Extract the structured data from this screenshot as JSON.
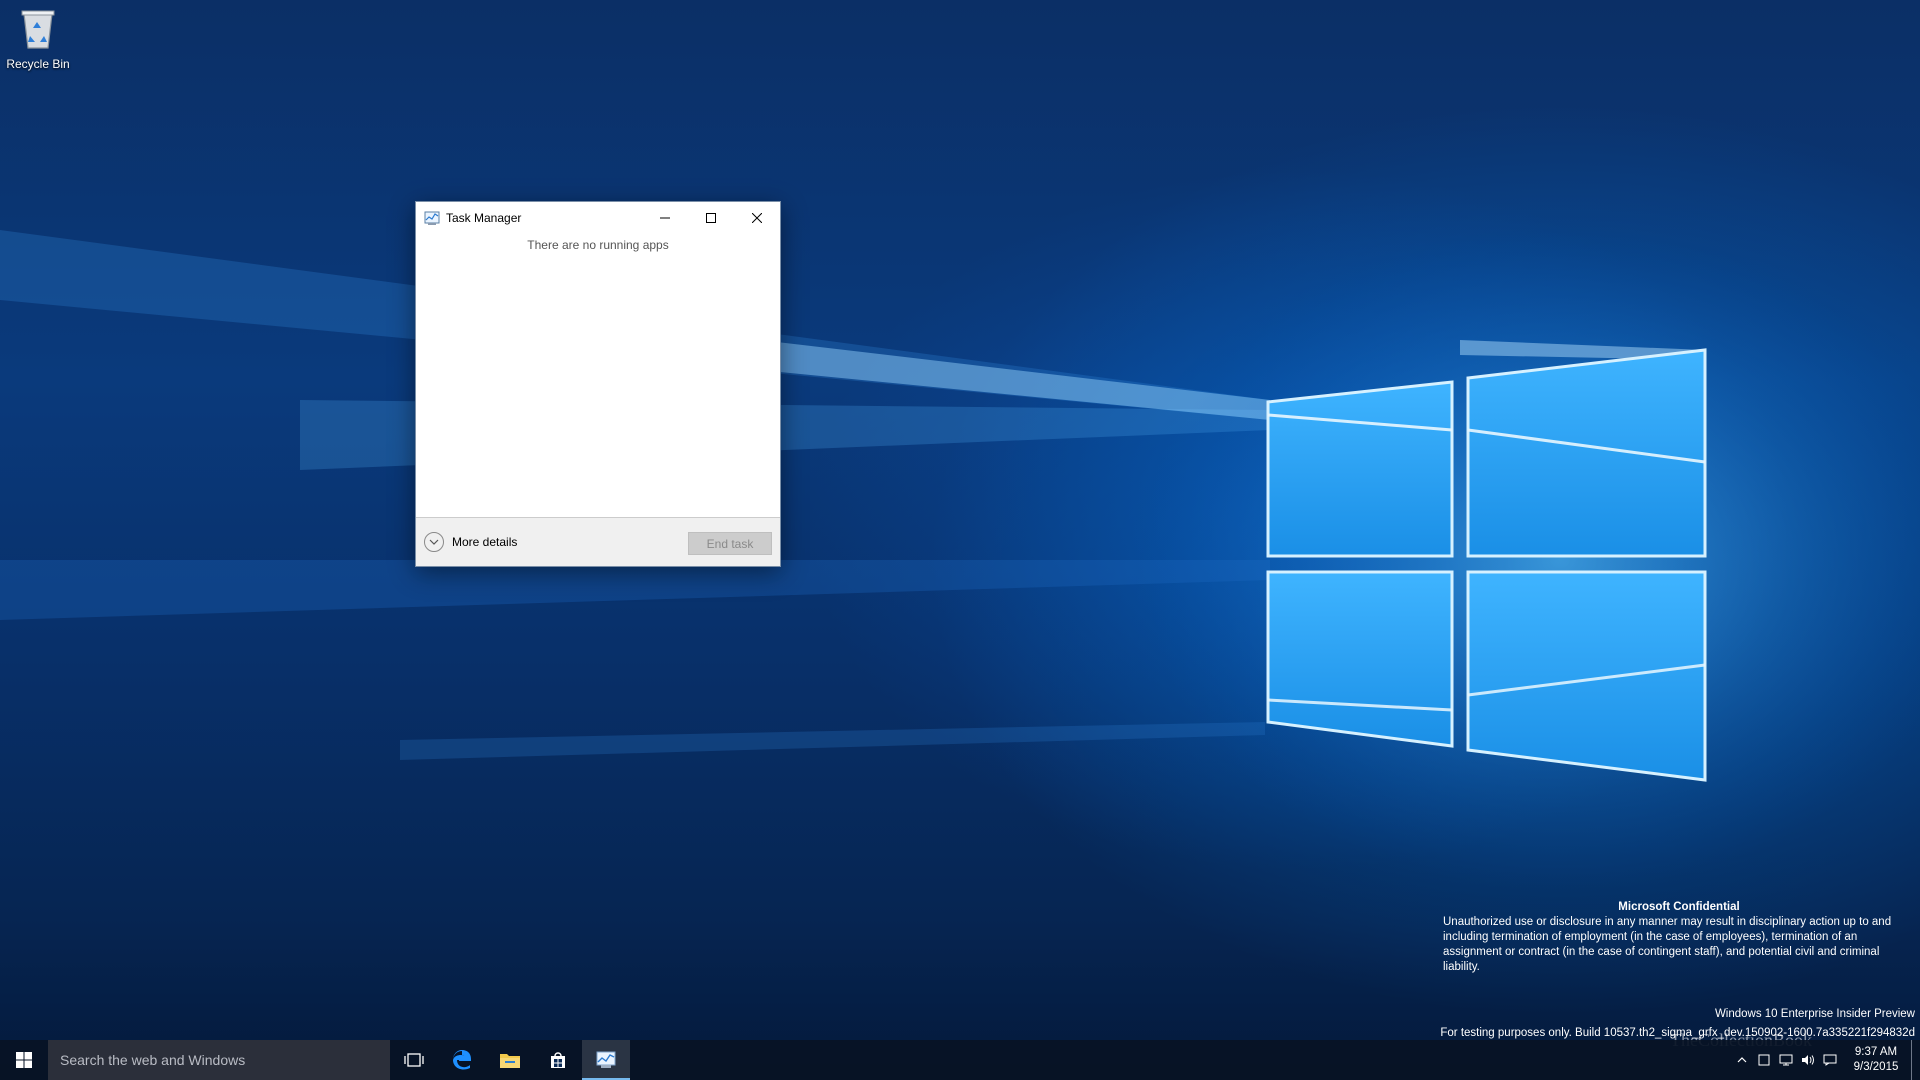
{
  "desktop": {
    "recycle_bin_label": "Recycle Bin"
  },
  "task_manager": {
    "title": "Task Manager",
    "empty_message": "There are no running apps",
    "more_details_label": "More details",
    "end_task_label": "End task"
  },
  "watermark": {
    "confidential_title": "Microsoft Confidential",
    "confidential_body": "Unauthorized use or disclosure in any manner may result in disciplinary action up to and including termination of employment (in the case of employees), termination of an assignment or contract (in the case of contingent staff), and potential civil and criminal liability.",
    "edition": "Windows 10 Enterprise Insider Preview",
    "build": "For testing purposes only. Build 10537.th2_sigma_grfx_dev.150902-1600.7a335221f294832d"
  },
  "taskbar": {
    "search_placeholder": "Search the web and Windows",
    "pinned": [
      "task-view",
      "edge",
      "file-explorer",
      "store",
      "task-manager"
    ],
    "active_app": "task-manager",
    "clock_time": "9:37 AM",
    "clock_date": "9/3/2015",
    "watermark_logo_text": "TheCollectionBook"
  },
  "colors": {
    "accent": "#0078d7",
    "taskbar_bg": "#081224",
    "window_border": "#7a8fa8"
  }
}
